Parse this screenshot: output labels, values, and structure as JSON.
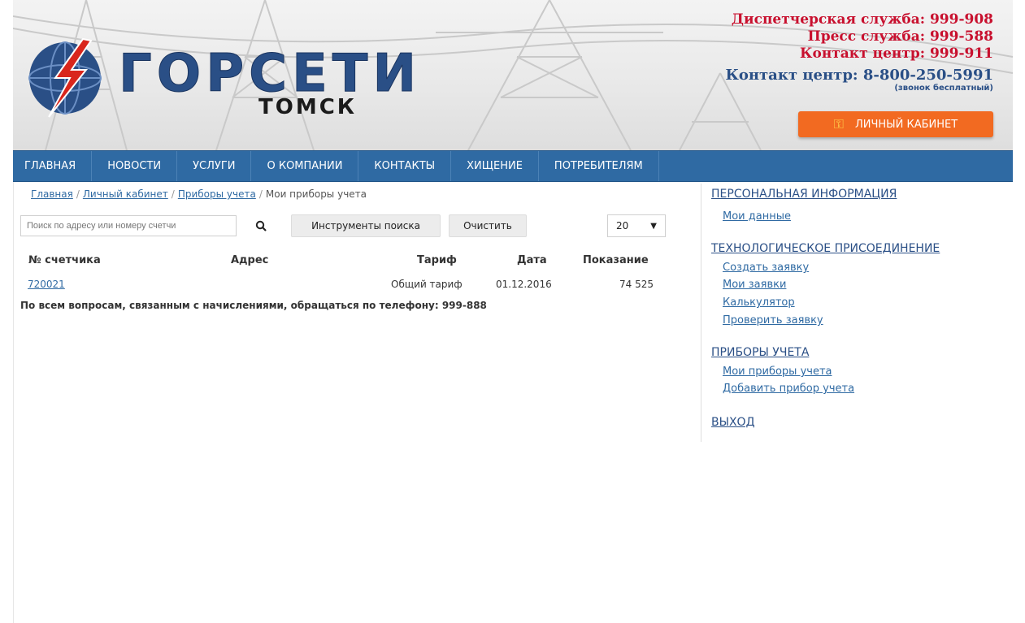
{
  "header": {
    "brand": "ГОРСЕТИ",
    "city": "ТОМСК",
    "contacts": {
      "dispatch": "Диспетчерская служба: 999-908",
      "press": "Пресс служба: 999-588",
      "contact_center": "Контакт центр: 999-911",
      "contact_center_phone": "Контакт центр: 8-800-250-5991",
      "free_call_note": "(звонок бесплатный)"
    },
    "cabinet_button": "ЛИЧНЫЙ КАБИНЕТ"
  },
  "nav": {
    "items": [
      "ГЛАВНАЯ",
      "НОВОСТИ",
      "УСЛУГИ",
      "О КОМПАНИИ",
      "КОНТАКТЫ",
      "ХИЩЕНИЕ",
      "ПОТРЕБИТЕЛЯМ"
    ]
  },
  "breadcrumb": {
    "items": [
      "Главная",
      "Личный кабинет",
      "Приборы учета"
    ],
    "current": "Мои приборы учета",
    "separator": "/"
  },
  "search": {
    "placeholder": "Поиск по адресу или номеру счетчи",
    "tools_label": "Инструменты поиска",
    "clear_label": "Очистить",
    "page_size": "20",
    "caret": "▼"
  },
  "table": {
    "headers": [
      "№ счетчика",
      "Адрес",
      "Тариф",
      "Дата",
      "Показание"
    ],
    "rows": [
      {
        "meter": "720021",
        "address": "",
        "tariff": "Общий тариф",
        "date": "01.12.2016",
        "reading": "74 525"
      }
    ]
  },
  "notice": "По всем вопросам, связанным с начислениями, обращаться по телефону: 999-888",
  "sidebar": {
    "personal": {
      "title": "ПЕРСОНАЛЬНАЯ ИНФОРМАЦИЯ",
      "links": [
        "Мои данные"
      ]
    },
    "tech": {
      "title": "ТЕХНОЛОГИЧЕСКОЕ ПРИСОЕДИНЕНИЕ",
      "links": [
        "Создать заявку",
        "Мои заявки",
        "Калькулятор",
        "Проверить заявку"
      ]
    },
    "meters": {
      "title": "ПРИБОРЫ УЧЕТА",
      "links": [
        "Мои приборы учета",
        "Добавить прибор учета"
      ]
    },
    "logout": "ВЫХОД"
  },
  "colors": {
    "nav": "#2f6aa3",
    "accent_red": "#c8102e",
    "brand_blue": "#2a4f86",
    "cabinet_orange": "#f26a21"
  }
}
